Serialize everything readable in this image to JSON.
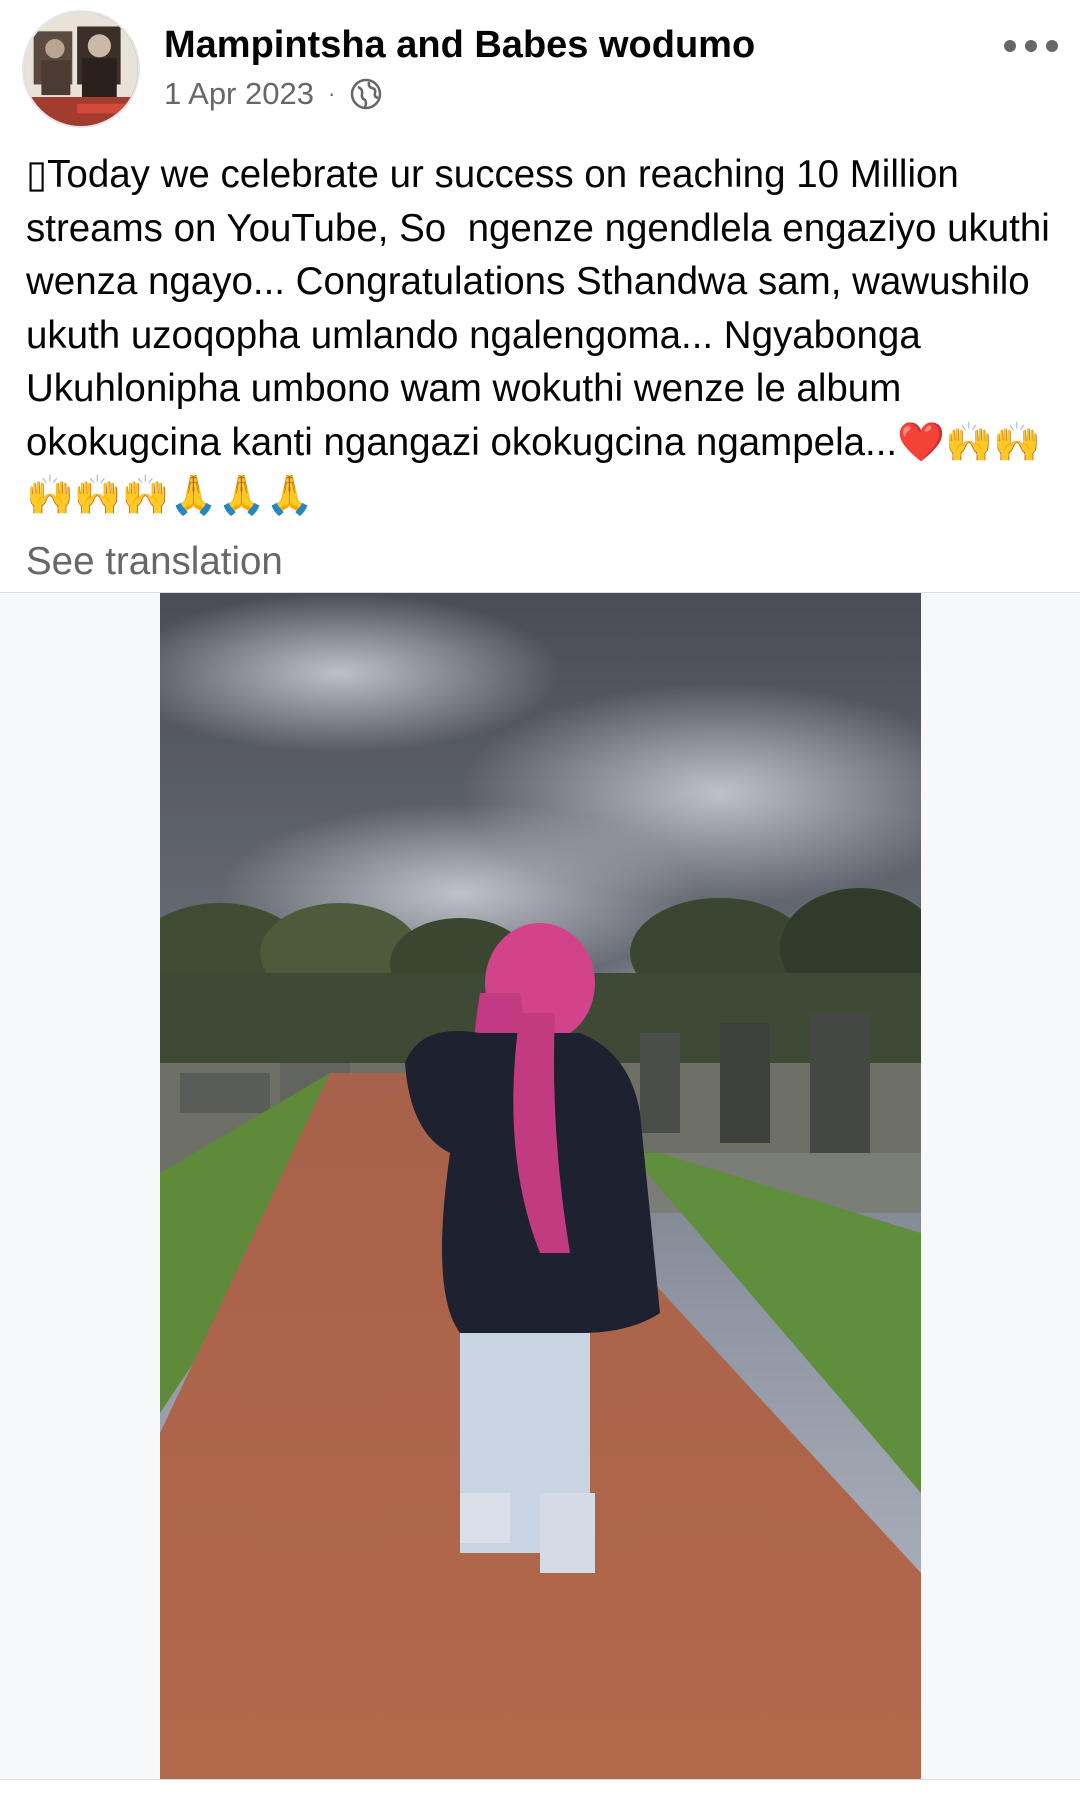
{
  "post": {
    "author": "Mampintsha and Babes wodumo",
    "date": "1 Apr 2023",
    "separator": "·",
    "privacy_icon": "globe-icon",
    "more_icon": "more-horizontal-icon",
    "text": "▯Today we celebrate ur success on reaching 10 Million streams on YouTube, So  ngenze ngendlela engaziyo ukuthi wenza ngayo... Congratulations Sthandwa sam, wawushilo ukuth uzoqopha umlando ngalengoma... Ngyabonga Ukuhlonipha umbono wam wokuthi wenze le album okokugcina kanti ngangazi okokugcina ngampela...❤️🙌🙌🙌🙌🙌🙏🙏🙏",
    "see_translation": "See translation"
  },
  "media": {
    "type": "video",
    "background": "#f7f8fa"
  },
  "colors": {
    "primary_text": "#050505",
    "secondary_text": "#65676b",
    "divider": "#dcdde1"
  }
}
